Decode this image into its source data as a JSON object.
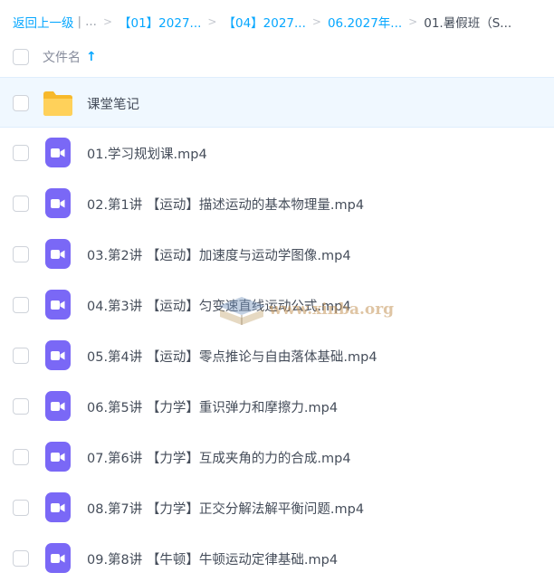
{
  "breadcrumb": {
    "back": "返回上一级",
    "divider": "|",
    "ellipsis": "...",
    "sep": ">",
    "items": [
      "【01】2027...",
      "【04】2027...",
      "06.2027年..."
    ],
    "current": "01.暑假班（S..."
  },
  "header": {
    "column_title": "文件名",
    "sort_arrow": "↑"
  },
  "files": [
    {
      "name": "课堂笔记",
      "type": "folder"
    },
    {
      "name": "01.学习规划课.mp4",
      "type": "video"
    },
    {
      "name": "02.第1讲 【运动】描述运动的基本物理量.mp4",
      "type": "video"
    },
    {
      "name": "03.第2讲 【运动】加速度与运动学图像.mp4",
      "type": "video"
    },
    {
      "name": "04.第3讲 【运动】匀变速直线运动公式.mp4",
      "type": "video"
    },
    {
      "name": "05.第4讲 【运动】零点推论与自由落体基础.mp4",
      "type": "video"
    },
    {
      "name": "06.第5讲 【力学】重识弹力和摩擦力.mp4",
      "type": "video"
    },
    {
      "name": "07.第6讲 【力学】互成夹角的力的合成.mp4",
      "type": "video"
    },
    {
      "name": "08.第7讲 【力学】正交分解法解平衡问题.mp4",
      "type": "video"
    },
    {
      "name": "09.第8讲 【牛顿】牛顿运动定律基础.mp4",
      "type": "video"
    }
  ],
  "watermark": {
    "text": "www.xinba.org"
  },
  "colors": {
    "accent": "#06a7ff",
    "video_icon": "#7a68f6",
    "folder": "#ffc93e",
    "selected_row": "#f0f8ff"
  }
}
